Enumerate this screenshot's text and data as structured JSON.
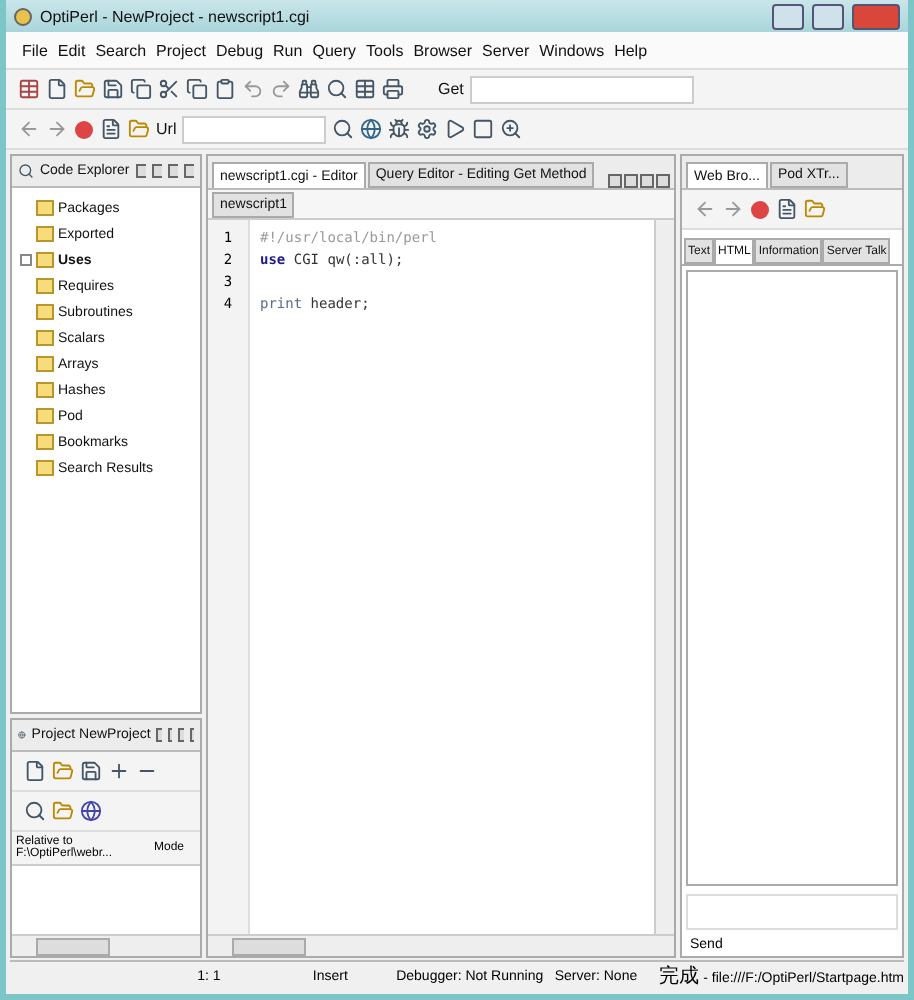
{
  "window": {
    "title": "OptiPerl - NewProject - newscript1.cgi"
  },
  "menu": [
    "File",
    "Edit",
    "Search",
    "Project",
    "Debug",
    "Run",
    "Query",
    "Tools",
    "Browser",
    "Server",
    "Windows",
    "Help"
  ],
  "toolbar": {
    "method_label": "Get",
    "url_label": "Url"
  },
  "code_explorer": {
    "title": "Code Explorer",
    "items": [
      {
        "label": "Packages",
        "bold": false,
        "expandable": false
      },
      {
        "label": "Exported",
        "bold": false,
        "expandable": false
      },
      {
        "label": "Uses",
        "bold": true,
        "expandable": true
      },
      {
        "label": "Requires",
        "bold": false,
        "expandable": false
      },
      {
        "label": "Subroutines",
        "bold": false,
        "expandable": false
      },
      {
        "label": "Scalars",
        "bold": false,
        "expandable": false
      },
      {
        "label": "Arrays",
        "bold": false,
        "expandable": false
      },
      {
        "label": "Hashes",
        "bold": false,
        "expandable": false
      },
      {
        "label": "Pod",
        "bold": false,
        "expandable": false
      },
      {
        "label": "Bookmarks",
        "bold": false,
        "expandable": false
      },
      {
        "label": "Search Results",
        "bold": false,
        "expandable": false
      }
    ]
  },
  "project": {
    "title": "Project NewProject",
    "columns": [
      "Relative to F:\\OptiPerl\\webr...",
      "Mode"
    ]
  },
  "editor": {
    "tabs": [
      {
        "label": "newscript1.cgi - Editor",
        "selected": true
      },
      {
        "label": "Query Editor - Editing Get Method",
        "selected": false
      }
    ],
    "file_tab": "newscript1",
    "lines": [
      {
        "number": "1",
        "tokens": [
          {
            "text": "#!/usr/local/bin/perl",
            "kind": "comment"
          }
        ]
      },
      {
        "number": "2",
        "tokens": [
          {
            "text": "use",
            "kind": "keyword"
          },
          {
            "text": " CGI qw(:all);",
            "kind": "plain"
          }
        ]
      },
      {
        "number": "3"
      },
      {
        "number": "4",
        "tokens": [
          {
            "text": "print",
            "kind": "function"
          },
          {
            "text": " header;",
            "kind": "plain"
          }
        ]
      }
    ]
  },
  "browser": {
    "tabs": [
      {
        "label": "Web Bro...",
        "selected": true
      },
      {
        "label": "Pod XTr...",
        "selected": false
      }
    ],
    "view_tabs": [
      {
        "label": "Text",
        "selected": false
      },
      {
        "label": "HTML",
        "selected": true
      },
      {
        "label": "Information",
        "selected": false
      },
      {
        "label": "Server Talk",
        "selected": false
      }
    ],
    "send_label": "Send",
    "status": "完成 - file:///F:/OptiPerl/Startpage.htm"
  },
  "status_bar": {
    "position": "1: 1",
    "mode": "Insert",
    "debugger": "Debugger: Not Running",
    "server": "Server: None"
  }
}
